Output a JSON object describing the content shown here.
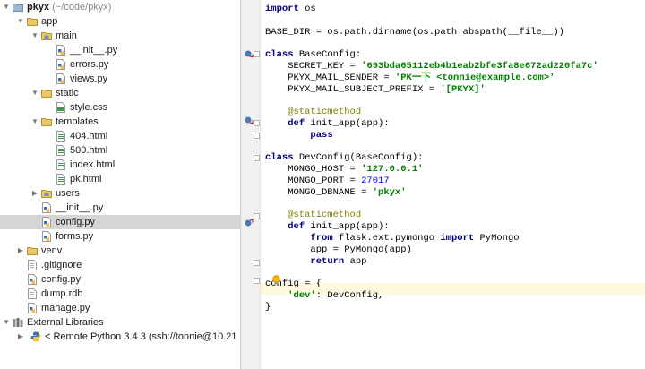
{
  "project": {
    "root": {
      "name": "pkyx",
      "path": "(~/code/pkyx)"
    },
    "items": [
      {
        "label": "app",
        "depth": 1,
        "kind": "folder",
        "expanded": true
      },
      {
        "label": "main",
        "depth": 2,
        "kind": "package",
        "expanded": true
      },
      {
        "label": "__init__.py",
        "depth": 3,
        "kind": "py"
      },
      {
        "label": "errors.py",
        "depth": 3,
        "kind": "py"
      },
      {
        "label": "views.py",
        "depth": 3,
        "kind": "py"
      },
      {
        "label": "static",
        "depth": 2,
        "kind": "folder",
        "expanded": true
      },
      {
        "label": "style.css",
        "depth": 3,
        "kind": "css"
      },
      {
        "label": "templates",
        "depth": 2,
        "kind": "folder",
        "expanded": true
      },
      {
        "label": "404.html",
        "depth": 3,
        "kind": "html"
      },
      {
        "label": "500.html",
        "depth": 3,
        "kind": "html"
      },
      {
        "label": "index.html",
        "depth": 3,
        "kind": "html"
      },
      {
        "label": "pk.html",
        "depth": 3,
        "kind": "html"
      },
      {
        "label": "users",
        "depth": 2,
        "kind": "package",
        "expanded": false
      },
      {
        "label": "__init__.py",
        "depth": 2,
        "kind": "py"
      },
      {
        "label": "config.py",
        "depth": 2,
        "kind": "py",
        "selected": true
      },
      {
        "label": "forms.py",
        "depth": 2,
        "kind": "py"
      },
      {
        "label": "venv",
        "depth": 1,
        "kind": "folder",
        "expanded": false
      },
      {
        "label": ".gitignore",
        "depth": 1,
        "kind": "text"
      },
      {
        "label": "config.py",
        "depth": 1,
        "kind": "py"
      },
      {
        "label": "dump.rdb",
        "depth": 1,
        "kind": "text"
      },
      {
        "label": "manage.py",
        "depth": 1,
        "kind": "py"
      }
    ],
    "libraries": {
      "label": "External Libraries",
      "remote": "< Remote Python 3.4.3 (ssh://tonnie@10.21"
    }
  },
  "editor": {
    "lines": [
      [
        {
          "t": "import",
          "c": "kw"
        },
        {
          "t": " os"
        }
      ],
      [],
      [
        {
          "t": "BASE_DIR = os.path.dirname(os.path.abspath(__file__))"
        }
      ],
      [],
      [
        {
          "t": "class",
          "c": "kw"
        },
        {
          "t": " BaseConfig:"
        }
      ],
      [
        {
          "t": "    SECRET_KEY = "
        },
        {
          "t": "'693bda65112eb4b1eab2bfe3fa8e672ad220fa7c'",
          "c": "str"
        }
      ],
      [
        {
          "t": "    PKYX_MAIL_SENDER = "
        },
        {
          "t": "'PK一下 <tonnie@example.com>'",
          "c": "str"
        }
      ],
      [
        {
          "t": "    PKYX_MAIL_SUBJECT_PREFIX = "
        },
        {
          "t": "'[PKYX]'",
          "c": "str"
        }
      ],
      [],
      [
        {
          "t": "    @staticmethod",
          "c": "deco"
        }
      ],
      [
        {
          "t": "    "
        },
        {
          "t": "def",
          "c": "kw"
        },
        {
          "t": " init_app(app):"
        }
      ],
      [
        {
          "t": "        "
        },
        {
          "t": "pass",
          "c": "kw"
        }
      ],
      [],
      [
        {
          "t": "class",
          "c": "kw"
        },
        {
          "t": " DevConfig(BaseConfig):"
        }
      ],
      [
        {
          "t": "    MONGO_HOST = "
        },
        {
          "t": "'127.0.0.1'",
          "c": "str"
        }
      ],
      [
        {
          "t": "    MONGO_PORT = "
        },
        {
          "t": "27017",
          "c": "num"
        }
      ],
      [
        {
          "t": "    MONGO_DBNAME = "
        },
        {
          "t": "'pkyx'",
          "c": "str"
        }
      ],
      [],
      [
        {
          "t": "    @staticmethod",
          "c": "deco"
        }
      ],
      [
        {
          "t": "    "
        },
        {
          "t": "def",
          "c": "kw"
        },
        {
          "t": " init_app(app):"
        }
      ],
      [
        {
          "t": "        "
        },
        {
          "t": "from",
          "c": "kw"
        },
        {
          "t": " flask.ext.pymongo "
        },
        {
          "t": "import",
          "c": "kw"
        },
        {
          "t": " PyMongo"
        }
      ],
      [
        {
          "t": "        app = PyMongo(app)"
        }
      ],
      [
        {
          "t": "        "
        },
        {
          "t": "return",
          "c": "kw"
        },
        {
          "t": " app"
        }
      ],
      [],
      [
        {
          "t": "config = {"
        }
      ],
      [
        {
          "t": "    "
        },
        {
          "t": "'dev'",
          "c": "str"
        },
        {
          "t": ": DevConfig,"
        }
      ],
      [
        {
          "t": "}"
        }
      ]
    ]
  },
  "colors": {
    "keyword": "#000080",
    "string": "#008000",
    "number": "#0000ff",
    "decorator": "#808000",
    "selection": "#d5d5d5",
    "caret_line": "#fff9e0"
  }
}
